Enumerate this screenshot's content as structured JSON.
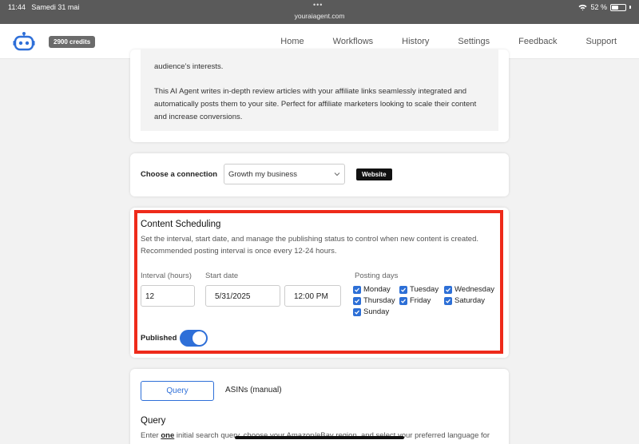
{
  "status_bar": {
    "time": "11:44",
    "date": "Samedi 31 mai",
    "url": "youraiagent.com",
    "battery": "52 %",
    "battery_level": 0.52
  },
  "header": {
    "credits": "2900 credits",
    "nav": [
      "Home",
      "Workflows",
      "History",
      "Settings",
      "Feedback",
      "Support"
    ]
  },
  "description": {
    "line_top": "audience’s interests.",
    "paragraph": "This AI Agent writes in-depth review articles with your affiliate links seamlessly integrated and automatically posts them to your site. Perfect for affiliate marketers looking to scale their content and increase conversions."
  },
  "connection": {
    "label": "Choose a connection",
    "selected": "Growth my business",
    "badge": "Website"
  },
  "scheduling": {
    "title": "Content Scheduling",
    "description": "Set the interval, start date, and manage the publishing status to control when new content is created. Recommended posting interval is once every 12-24 hours.",
    "interval_label": "Interval (hours)",
    "interval_value": "12",
    "start_label": "Start date",
    "start_date": "5/31/2025",
    "start_time": "12:00 PM",
    "days_label": "Posting days",
    "days": [
      "Monday",
      "Tuesday",
      "Wednesday",
      "Thursday",
      "Friday",
      "Saturday",
      "Sunday"
    ],
    "published_label": "Published",
    "accent": "#2e6fd8",
    "highlight_color": "#ee2a1a"
  },
  "query": {
    "tab_query": "Query",
    "tab_asins": "ASINs (manual)",
    "title": "Query",
    "desc_prefix": "Enter ",
    "desc_bold": "one",
    "desc_rest": " initial search query, choose your Amazon/eBay region, and select your preferred language for"
  }
}
